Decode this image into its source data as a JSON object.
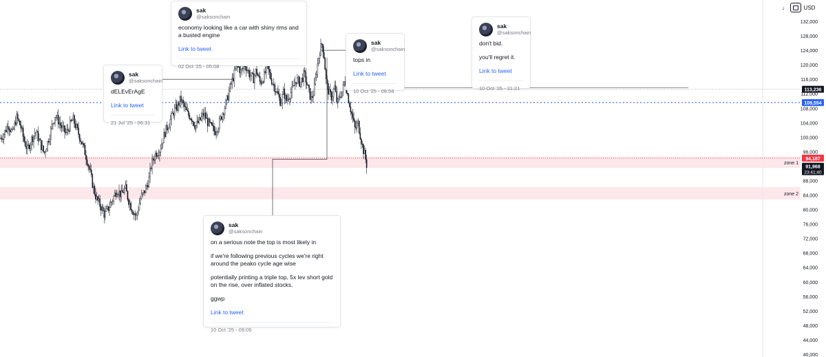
{
  "toolbar": {
    "arrow_icon": "arrow-down-icon",
    "fit_icon": "fit-screen-icon",
    "currency": "USD"
  },
  "chart_data": {
    "type": "candlestick",
    "y_ticks": [
      "40,000",
      "44,000",
      "48,000",
      "52,000",
      "56,000",
      "60,000",
      "64,000",
      "68,000",
      "72,000",
      "76,000",
      "80,000",
      "84,000",
      "88,000",
      "92,000",
      "96,000",
      "100,000",
      "104,000",
      "108,000",
      "112,000",
      "116,000",
      "120,000",
      "124,000",
      "128,000",
      "132,000"
    ],
    "ylim": [
      40000,
      134000
    ],
    "price_labels": [
      {
        "id": "price-level-upper",
        "text": "113,236",
        "value": 113236,
        "color": "#131722"
      },
      {
        "id": "price-level-dotted",
        "text": "109,554",
        "value": 109554,
        "color": "#2962ff"
      },
      {
        "id": "price-level-zone",
        "text": "94,187",
        "value": 94187,
        "color": "#f23645"
      },
      {
        "id": "current-price",
        "text": "91,968",
        "sub": "23:41:40",
        "value": 91968,
        "color": "#131722"
      }
    ],
    "zones": [
      {
        "name": "zone 1",
        "from": 91500,
        "to": 94600
      },
      {
        "name": "zone 2",
        "from": 82800,
        "to": 86200
      }
    ],
    "close_path": [
      [
        0,
        99500
      ],
      [
        6,
        101000
      ],
      [
        12,
        103500
      ],
      [
        18,
        101000
      ],
      [
        24,
        105500
      ],
      [
        30,
        103000
      ],
      [
        35,
        99000
      ],
      [
        40,
        96500
      ],
      [
        46,
        99500
      ],
      [
        52,
        101500
      ],
      [
        58,
        98500
      ],
      [
        64,
        95500
      ],
      [
        70,
        99000
      ],
      [
        76,
        103500
      ],
      [
        80,
        106000
      ],
      [
        85,
        104500
      ],
      [
        90,
        102500
      ],
      [
        96,
        101000
      ],
      [
        102,
        103500
      ],
      [
        106,
        105000
      ],
      [
        112,
        102000
      ],
      [
        118,
        99000
      ],
      [
        124,
        95500
      ],
      [
        130,
        91000
      ],
      [
        135,
        86500
      ],
      [
        140,
        83000
      ],
      [
        146,
        81000
      ],
      [
        152,
        78500
      ],
      [
        158,
        80500
      ],
      [
        164,
        83000
      ],
      [
        170,
        85500
      ],
      [
        176,
        84000
      ],
      [
        182,
        86000
      ],
      [
        186,
        83000
      ],
      [
        192,
        80000
      ],
      [
        198,
        78000
      ],
      [
        204,
        83000
      ],
      [
        210,
        85000
      ],
      [
        216,
        88000
      ],
      [
        220,
        92500
      ],
      [
        226,
        95500
      ],
      [
        232,
        96500
      ],
      [
        236,
        99000
      ],
      [
        240,
        101500
      ],
      [
        246,
        104000
      ],
      [
        252,
        107000
      ],
      [
        258,
        108500
      ],
      [
        262,
        110500
      ],
      [
        266,
        109000
      ],
      [
        272,
        106500
      ],
      [
        278,
        105500
      ],
      [
        284,
        103000
      ],
      [
        290,
        104500
      ],
      [
        296,
        106500
      ],
      [
        302,
        104000
      ],
      [
        308,
        102500
      ],
      [
        312,
        101500
      ],
      [
        318,
        103500
      ],
      [
        322,
        106000
      ],
      [
        326,
        108000
      ],
      [
        330,
        110500
      ],
      [
        334,
        113500
      ],
      [
        338,
        116000
      ],
      [
        342,
        118500
      ],
      [
        346,
        119500
      ],
      [
        350,
        118000
      ],
      [
        356,
        120000
      ],
      [
        362,
        117500
      ],
      [
        368,
        116000
      ],
      [
        372,
        118500
      ],
      [
        378,
        115000
      ],
      [
        384,
        117000
      ],
      [
        388,
        119500
      ],
      [
        394,
        116000
      ],
      [
        400,
        113500
      ],
      [
        404,
        111500
      ],
      [
        408,
        109500
      ],
      [
        412,
        112500
      ],
      [
        416,
        110000
      ],
      [
        420,
        111500
      ],
      [
        426,
        113500
      ],
      [
        430,
        116000
      ],
      [
        436,
        115000
      ],
      [
        442,
        117500
      ],
      [
        448,
        113000
      ],
      [
        452,
        110500
      ],
      [
        456,
        112500
      ],
      [
        460,
        118500
      ],
      [
        464,
        123500
      ],
      [
        468,
        126000
      ],
      [
        471,
        122000
      ],
      [
        474,
        115000
      ],
      [
        478,
        112000
      ],
      [
        482,
        111000
      ],
      [
        486,
        114000
      ],
      [
        490,
        109000
      ],
      [
        494,
        111500
      ],
      [
        498,
        113000
      ],
      [
        501,
        116000
      ],
      [
        504,
        112500
      ],
      [
        508,
        109000
      ],
      [
        512,
        105500
      ],
      [
        516,
        102000
      ],
      [
        520,
        104000
      ],
      [
        524,
        100000
      ],
      [
        527,
        97000
      ],
      [
        530,
        95000
      ],
      [
        533,
        92000
      ]
    ],
    "tweets_anchor_y": [
      {
        "x": 236,
        "y": 116000
      },
      {
        "x": 441,
        "y": 120000
      },
      {
        "x": 470,
        "y": 123000
      },
      {
        "x": 560,
        "y": 113600
      },
      {
        "x": 475,
        "y": 94000
      }
    ]
  },
  "tweets": [
    {
      "id": "tweet-dELEvErAgE",
      "name": "sak",
      "handle": "@saksonchain",
      "lines": [
        "dELEvErAgE"
      ],
      "link": "Link to tweet",
      "date": "21 Jul '25 - 06:31"
    },
    {
      "id": "tweet-economy",
      "name": "sak",
      "handle": "@saksonchain",
      "lines": [
        "economy looking like a car with shiny rims and a busted engine"
      ],
      "link": "Link to tweet",
      "date": "02 Oct '25 - 05:08"
    },
    {
      "id": "tweet-tops-in",
      "name": "sak",
      "handle": "@saksonchain",
      "lines": [
        "tops in"
      ],
      "link": "Link to tweet",
      "date": "10 Oct '25 - 08:58"
    },
    {
      "id": "tweet-dont-bid",
      "name": "sak",
      "handle": "@saksonchain",
      "lines": [
        "don't bid.",
        "you'll regret it."
      ],
      "link": "Link to tweet",
      "date": "10 Oct '25 - 21:21"
    },
    {
      "id": "tweet-serious-note",
      "name": "sak",
      "handle": "@saksonchain",
      "lines": [
        "on a serious note the top is most likely in",
        "if we're following previous cycles we're right around the peako cycle age wise",
        "potentially printing a triple top, 5x lev short gold on the rise, over inflated stocks.",
        "ggwp"
      ],
      "link": "Link to tweet",
      "date": "10 Oct '25 - 09:05"
    }
  ]
}
